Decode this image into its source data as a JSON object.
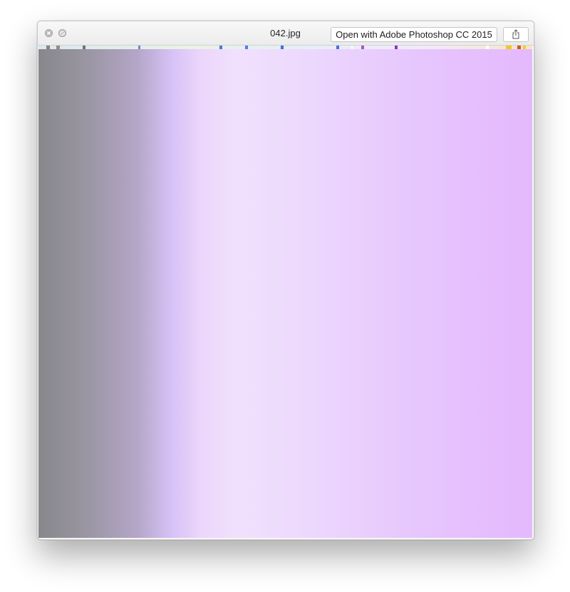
{
  "window": {
    "title": "042.jpg",
    "open_with_label": "Open with Adobe Photoshop CC 2015",
    "share_icon": "share-icon",
    "close_icon": "close-icon",
    "fullscreen_icon": "fullscreen-disabled-icon"
  },
  "image": {
    "description_colors": [
      "#87878b",
      "#d6c2f6",
      "#f1e0fd",
      "#e4b8fd"
    ]
  }
}
